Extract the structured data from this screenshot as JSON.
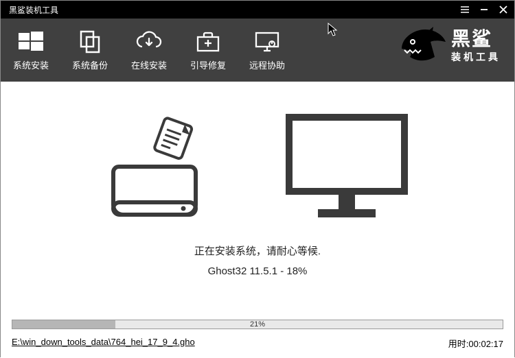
{
  "window": {
    "title": "黑鲨装机工具"
  },
  "toolbar": {
    "items": [
      {
        "label": "系统安装",
        "icon": "windows"
      },
      {
        "label": "系统备份",
        "icon": "copy"
      },
      {
        "label": "在线安装",
        "icon": "cloud-download"
      },
      {
        "label": "引导修复",
        "icon": "briefcase-plus"
      },
      {
        "label": "远程协助",
        "icon": "remote-monitor"
      }
    ]
  },
  "brand": {
    "line1": "黑鲨",
    "line2": "装机工具"
  },
  "status": {
    "line1": "正在安装系统，请耐心等候.",
    "line2_prefix": "Ghost32 11.5.1 - ",
    "percent_text": "18%"
  },
  "progress": {
    "percent": 21,
    "percent_label": "21%"
  },
  "footer": {
    "path": "E:\\win_down_tools_data\\764_hei_17_9_4.gho",
    "time_label": "用时:",
    "time_value": "00:02:17"
  },
  "colors": {
    "titlebar": "#000000",
    "toolbar": "#404040",
    "progress_fill": "#b6b6b6"
  }
}
